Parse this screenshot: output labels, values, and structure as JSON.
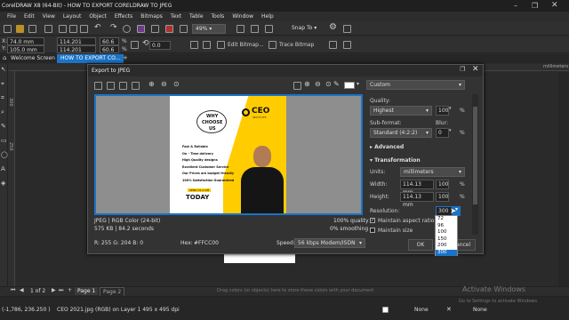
{
  "app": {
    "title": "CorelDRAW X8 (64-Bit) - HOW TO  EXPORT CORELDRAW TO JPEG"
  },
  "menu": [
    "File",
    "Edit",
    "View",
    "Layout",
    "Object",
    "Effects",
    "Bitmaps",
    "Text",
    "Table",
    "Tools",
    "Window",
    "Help"
  ],
  "toolbar": {
    "zoom": "49%",
    "snap": "Snap To"
  },
  "props": {
    "x": "74.0 mm",
    "y": "105.0 mm",
    "w": "114.201 mm",
    "h": "114.201 mm",
    "sx": "60.6",
    "sy": "60.6",
    "pct": "%",
    "angle": "0.0",
    "edit_bitmap": "Edit Bitmap...",
    "trace_bitmap": "Trace Bitmap"
  },
  "doc_tabs": [
    "Welcome Screen",
    "HOW TO  EXPORT CO..."
  ],
  "ruler_unit": "millimeters",
  "ruler_labels": [
    "300",
    "250"
  ],
  "dialog": {
    "title": "Export to JPEG",
    "preset": "Custom",
    "quality_label": "Quality:",
    "quality": "Highest",
    "quality_val": "100",
    "pct": "%",
    "subformat_label": "Sub-format:",
    "blur_label": "Blur:",
    "subformat": "Standard (4:2:2)",
    "blur": "0",
    "advanced": "Advanced",
    "transformation": "Transformation",
    "units_label": "Units:",
    "units": "millimeters",
    "width_label": "Width:",
    "width": "114.13 mm",
    "width_pct": "100",
    "height_label": "Height:",
    "height": "114.13 mm",
    "height_pct": "100",
    "resolution_label": "Resolution:",
    "resolution": "300",
    "res_options": [
      "72",
      "96",
      "100",
      "150",
      "200",
      "300"
    ],
    "maintain_aspect": "Maintain aspect ratio",
    "maintain_size": "Maintain size",
    "info_format": "JPEG  |  RGB Color (24-bit)",
    "info_size": "575 KB  |  84.2 seconds",
    "info_quality": "100% quality",
    "info_smooth": "0% smoothing",
    "rgb": "R: 255   G: 204   B: 0",
    "hex_label": "Hex:",
    "hex": "#FFCC00",
    "speed_label": "Speed:",
    "speed": "56 kbps Modem/ISDN",
    "ok": "OK",
    "cancel": "Cancel"
  },
  "poster": {
    "why": "WHY",
    "choose": "CHOOSE",
    "us": "US",
    "logo": "CEO",
    "logo_sub": "INSTITUTE",
    "bullets": [
      "Fast & Reliable",
      "On - Time delivery",
      "High Quality designs",
      "Excellent Customer Service",
      "Our Prices are budget friendly",
      "100% Satisfaction Guaranteed"
    ],
    "send": "SEND US A DM",
    "today": "TODAY"
  },
  "statusbar": {
    "coords": "(-1,786, 236.250 )",
    "info": "CEO 2021.jpg (RGB) on Layer 1 495 x 495 dpi",
    "fill": "None",
    "outline": "None"
  },
  "pages": {
    "counter": "1 of 2",
    "page1": "Page 1",
    "page2": "Page 2",
    "hint": "Drag colors (or objects) here to store these colors with your document"
  },
  "watermark": {
    "line1": "Activate Windows",
    "line2": "Go to Settings to activate Windows."
  },
  "colors": {
    "accent": "#1b73c7",
    "yellow": "#ffcc00"
  }
}
